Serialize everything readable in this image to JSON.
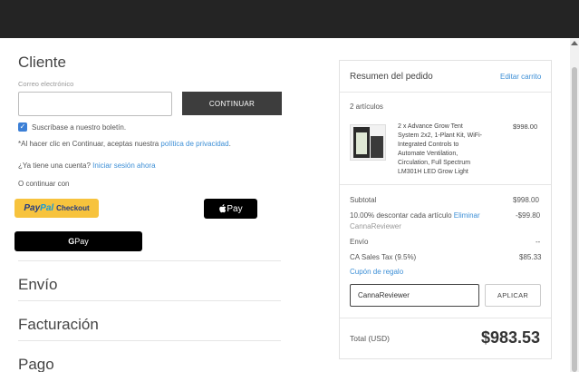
{
  "customer": {
    "title": "Cliente",
    "email_label": "Correo electrónico",
    "email_value": "",
    "continue_label": "CONTINUAR",
    "newsletter_label": "Suscríbase a nuestro boletín.",
    "newsletter_checked": true,
    "privacy_prefix": "*Al hacer clic en Continuar, aceptas nuestra ",
    "privacy_link": "política de privacidad",
    "privacy_suffix": ".",
    "account_prefix": "¿Ya tiene una cuenta? ",
    "account_link": "Iniciar sesión ahora",
    "or_continue": "O continuar con"
  },
  "wallets": {
    "paypal_part1": "Pay",
    "paypal_part2": "Pal",
    "paypal_suffix": "Checkout",
    "applepay": " Pay",
    "gpay_g": "G",
    "gpay_text": " Pay"
  },
  "sections": {
    "shipping": "Envío",
    "billing": "Facturación",
    "payment": "Pago"
  },
  "summary": {
    "title": "Resumen del pedido",
    "edit_cart": "Editar carrito",
    "items_count": "2 artículos",
    "item": {
      "lines": [
        "2 x Advance Grow Tent",
        "System 2x2, 1-Plant Kit, WiFi-",
        "Integrated Controls to",
        "Automate Ventilation,",
        "Circulation, Full Spectrum",
        "LM301H LED Grow Light"
      ],
      "price": "$998.00"
    },
    "subtotal_label": "Subtotal",
    "subtotal_value": "$998.00",
    "discount_label": "10.00% descontar cada artículo ",
    "discount_remove": "Eliminar",
    "discount_code": "CannaReviewer",
    "discount_value": "-$99.80",
    "shipping_label": "Envío",
    "shipping_value": "--",
    "tax_label": "CA Sales Tax (9.5%)",
    "tax_value": "$85.33",
    "gift_coupon": "Cupón de regalo",
    "coupon_value": "CannaReviewer",
    "apply_label": "APLICAR",
    "total_label": "Total (USD)",
    "total_value": "$983.53"
  }
}
